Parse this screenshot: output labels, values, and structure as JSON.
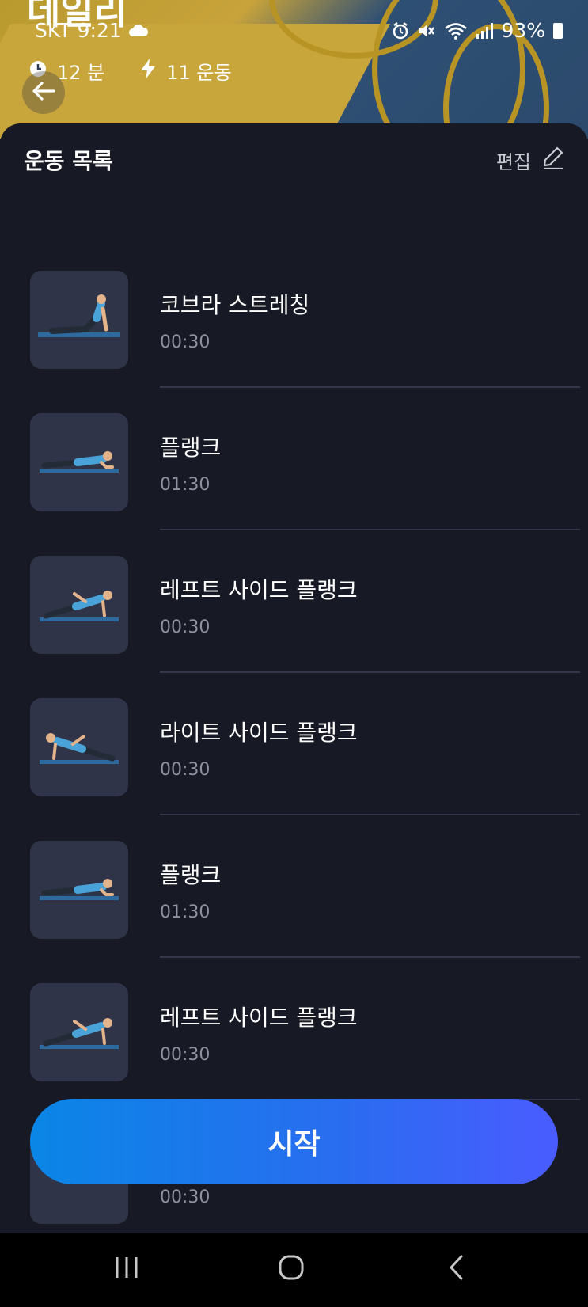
{
  "status_bar": {
    "carrier_time": "SKT 9:21",
    "battery": "93%",
    "icons": [
      "cloud-icon",
      "alarm-icon",
      "mute-icon",
      "wifi-icon",
      "signal-icon",
      "battery-icon"
    ]
  },
  "header": {
    "title": "데일리",
    "duration": "12 분",
    "exercise_count": "11 운동"
  },
  "sheet": {
    "title": "운동 목록",
    "edit_label": "편집"
  },
  "exercises": [
    {
      "name": "코브라 스트레칭",
      "duration": "00:30",
      "pose": "cobra"
    },
    {
      "name": "플랭크",
      "duration": "01:30",
      "pose": "plank"
    },
    {
      "name": "레프트 사이드 플랭크",
      "duration": "00:30",
      "pose": "side-plank-left"
    },
    {
      "name": "라이트 사이드 플랭크",
      "duration": "00:30",
      "pose": "side-plank-right"
    },
    {
      "name": "플랭크",
      "duration": "01:30",
      "pose": "plank"
    },
    {
      "name": "레프트 사이드 플랭크",
      "duration": "00:30",
      "pose": "side-plank-left"
    },
    {
      "name": "",
      "duration": "00:30",
      "pose": "partial"
    }
  ],
  "start_button": {
    "label": "시작"
  },
  "colors": {
    "background": "#171925",
    "thumb": "#2f3449",
    "accent_start": "#0a86e6",
    "accent_end": "#4a5cff",
    "muted_text": "#8d91a0"
  }
}
